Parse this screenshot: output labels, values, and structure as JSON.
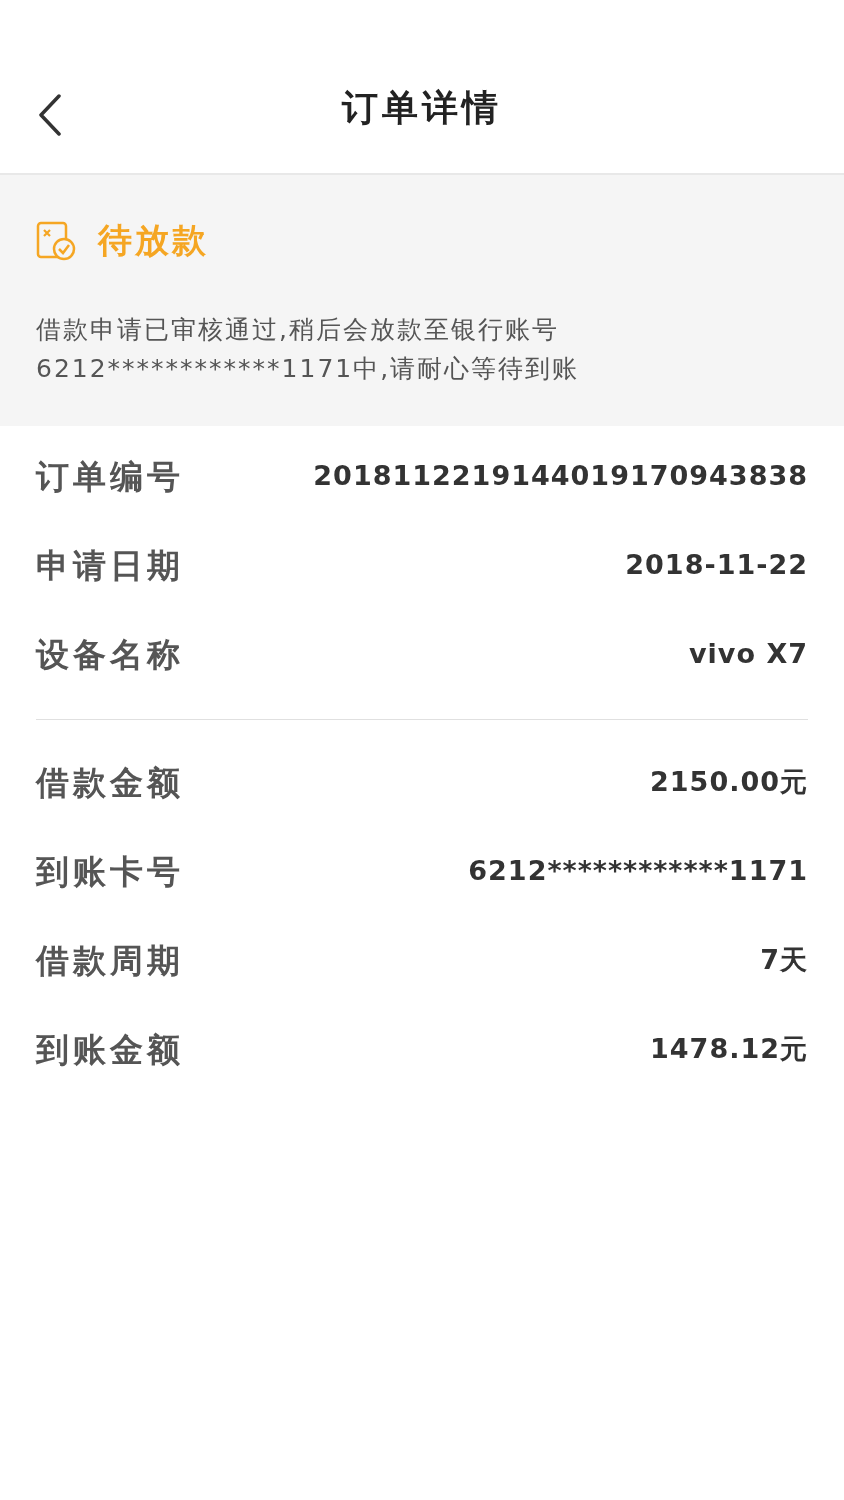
{
  "header": {
    "title": "订单详情"
  },
  "status": {
    "label": "待放款",
    "message": "借款申请已审核通过,稍后会放款至银行账号6212************1171中,请耐心等待到账"
  },
  "sections": [
    {
      "rows": [
        {
          "label": "订单编号",
          "value": "2018112219144019170943838"
        },
        {
          "label": "申请日期",
          "value": "2018-11-22"
        },
        {
          "label": "设备名称",
          "value": "vivo X7"
        }
      ]
    },
    {
      "rows": [
        {
          "label": "借款金额",
          "value": "2150.00元"
        },
        {
          "label": "到账卡号",
          "value": "6212************1171"
        },
        {
          "label": "借款周期",
          "value": "7天"
        },
        {
          "label": "到账金额",
          "value": "1478.12元"
        }
      ]
    }
  ]
}
